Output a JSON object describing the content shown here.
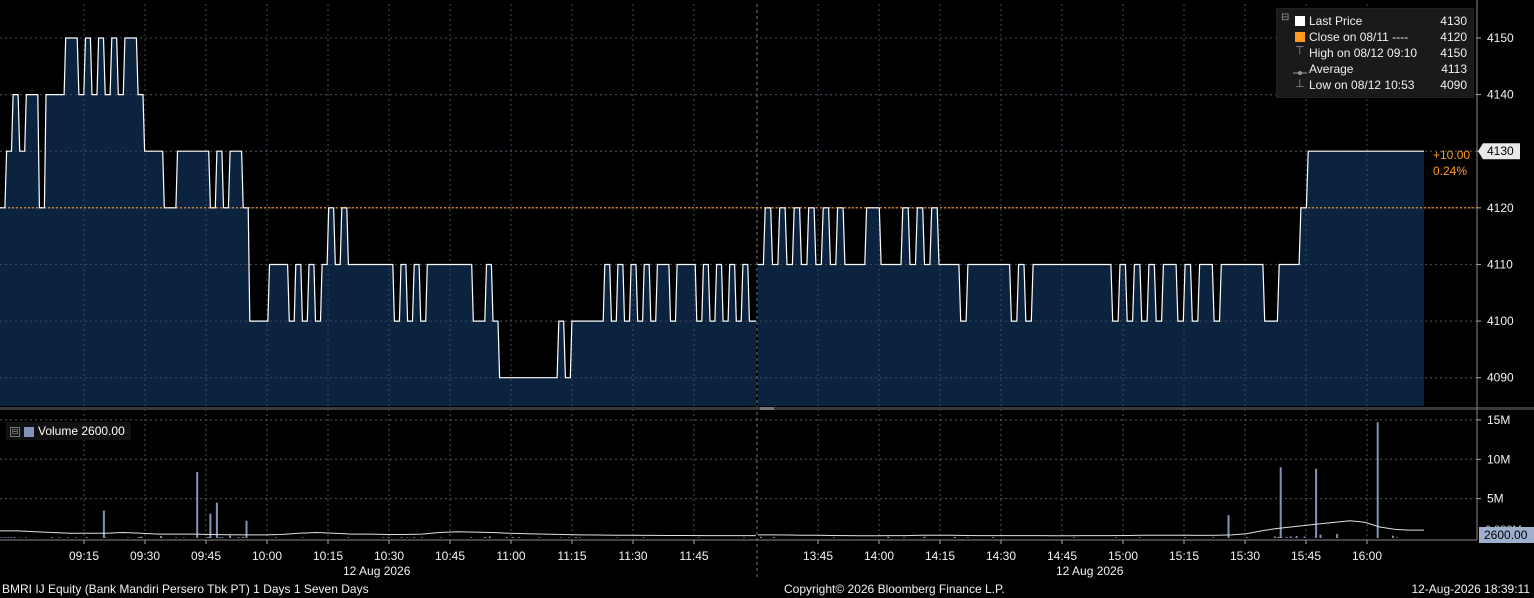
{
  "chart_data": {
    "type": "area",
    "ylim": [
      4085,
      4156
    ],
    "price_ticks": [
      4090,
      4100,
      4110,
      4120,
      4130,
      4140,
      4150
    ],
    "volume_ticks": [
      {
        "v": 15,
        "label": "15M"
      },
      {
        "v": 10,
        "label": "10M"
      },
      {
        "v": 5,
        "label": "5M"
      }
    ],
    "volume_ylim": [
      0,
      15.5
    ],
    "volume_unit": "M",
    "session1_time_labels": [
      "09:15",
      "09:30",
      "09:45",
      "10:00",
      "10:15",
      "10:30",
      "10:45",
      "11:00",
      "11:15",
      "11:30",
      "11:45"
    ],
    "session2_time_labels": [
      "13:45",
      "14:00",
      "14:15",
      "14:30",
      "14:45",
      "15:00",
      "15:15",
      "15:30",
      "15:45",
      "16:00"
    ],
    "date_label": "12 Aug 2026",
    "previous_close": 4120,
    "last_price": 4130,
    "last_price_tag": "4130",
    "change_abs": "+10.00",
    "change_pct": "0.24%",
    "session1": [
      4120,
      4130,
      4140,
      4130,
      4140,
      4140,
      4120,
      4140,
      4140,
      4140,
      4150,
      4150,
      4140,
      4150,
      4140,
      4150,
      4140,
      4150,
      4140,
      4150,
      4150,
      4140,
      4130,
      4130,
      4130,
      4120,
      4120,
      4130,
      4130,
      4130,
      4130,
      4130,
      4120,
      4130,
      4120,
      4130,
      4130,
      4120,
      4100,
      4100,
      4100,
      4110,
      4110,
      4110,
      4100,
      4110,
      4100,
      4110,
      4100,
      4110,
      4120,
      4110,
      4120,
      4110,
      4110,
      4110,
      4110,
      4110,
      4110,
      4110,
      4100,
      4110,
      4100,
      4110,
      4100,
      4110,
      4110,
      4110,
      4110,
      4110,
      4110,
      4110,
      4100,
      4100,
      4110,
      4100,
      4090,
      4090,
      4090,
      4090,
      4090,
      4090,
      4090,
      4090,
      4090,
      4100,
      4090,
      4100,
      4100,
      4100,
      4100,
      4100,
      4110,
      4100,
      4110,
      4100,
      4110,
      4100,
      4110,
      4100,
      4110,
      4110,
      4100,
      4110,
      4110,
      4110,
      4100,
      4110,
      4100,
      4110,
      4100,
      4110,
      4100,
      4110,
      4100
    ],
    "session2": [
      4110,
      4120,
      4110,
      4120,
      4110,
      4120,
      4110,
      4120,
      4110,
      4120,
      4110,
      4120,
      4110,
      4110,
      4110,
      4120,
      4120,
      4110,
      4110,
      4110,
      4120,
      4110,
      4120,
      4110,
      4120,
      4110,
      4110,
      4110,
      4100,
      4110,
      4110,
      4110,
      4110,
      4110,
      4110,
      4100,
      4110,
      4100,
      4110,
      4110,
      4110,
      4110,
      4110,
      4110,
      4110,
      4110,
      4110,
      4110,
      4110,
      4100,
      4110,
      4100,
      4110,
      4100,
      4110,
      4100,
      4110,
      4110,
      4100,
      4110,
      4100,
      4110,
      4110,
      4100,
      4110,
      4110,
      4110,
      4110,
      4110,
      4110,
      4100,
      4100,
      4110,
      4110,
      4110,
      4120,
      4130,
      4130,
      4130,
      4130,
      4130,
      4130,
      4130,
      4130,
      4130,
      4130,
      4130,
      4130,
      4130,
      4130,
      4130,
      4130
    ],
    "volume_spikes_s1": [
      [
        0.1,
        0.07
      ],
      [
        0.5,
        0.06
      ],
      [
        0.9,
        0.09
      ],
      [
        1.3,
        0.08
      ],
      [
        1.7,
        0.07
      ],
      [
        2.2,
        0.1
      ],
      [
        3.0,
        0.05
      ],
      [
        4.0,
        0.06
      ],
      [
        5.5,
        0.04
      ],
      [
        7.9,
        0.1
      ],
      [
        9.0,
        0.08
      ],
      [
        10.3,
        0.07
      ],
      [
        11.6,
        0.08
      ],
      [
        13.2,
        0.1
      ],
      [
        16.0,
        0.07
      ],
      [
        19.5,
        0.06
      ],
      [
        21.1,
        0.13
      ],
      [
        21.5,
        0.16
      ],
      [
        24.5,
        0.25
      ],
      [
        26.8,
        0.06
      ],
      [
        28.0,
        0.05
      ],
      [
        31.4,
        0.07
      ],
      [
        31.7,
        0.12
      ],
      [
        33.4,
        0.1
      ],
      [
        33.8,
        0.09
      ],
      [
        35.0,
        0.3
      ],
      [
        36.3,
        0.12
      ],
      [
        37.0,
        0.14
      ],
      [
        42.0,
        0.07
      ],
      [
        46.0,
        0.06
      ],
      [
        53.0,
        0.08
      ],
      [
        58.3,
        0.08
      ],
      [
        59.1,
        0.11
      ],
      [
        61.1,
        0.1
      ],
      [
        62.0,
        0.08
      ],
      [
        63.0,
        0.09
      ],
      [
        64.2,
        0.07
      ],
      [
        67.0,
        0.06
      ],
      [
        71.7,
        0.09
      ],
      [
        73.8,
        0.14
      ],
      [
        74.5,
        0.19
      ],
      [
        77.1,
        0.12
      ],
      [
        78.0,
        0.11
      ],
      [
        79.0,
        0.1
      ],
      [
        82.0,
        0.08
      ],
      [
        85.3,
        0.06
      ],
      [
        86.6,
        0.07
      ],
      [
        87.6,
        0.1
      ],
      [
        88.2,
        0.09
      ],
      [
        93.9,
        0.05
      ],
      [
        97.9,
        0.08
      ],
      [
        106.3,
        0.07
      ],
      [
        113.2,
        0.06
      ]
    ],
    "volume_spikes_s2": [
      [
        0.4,
        0.15
      ],
      [
        2.2,
        0.11
      ],
      [
        10.5,
        0.08
      ],
      [
        18.0,
        0.15
      ],
      [
        20.2,
        0.07
      ],
      [
        23.0,
        0.16
      ],
      [
        27.2,
        0.14
      ],
      [
        29.0,
        0.08
      ],
      [
        32.5,
        0.12
      ],
      [
        43.7,
        0.07
      ],
      [
        49.5,
        0.08
      ],
      [
        52.7,
        0.09
      ],
      [
        59.0,
        0.09
      ],
      [
        62.9,
        0.09
      ],
      [
        67.6,
        0.1
      ],
      [
        71.4,
        0.19
      ],
      [
        71.9,
        0.14
      ],
      [
        72.3,
        0.11
      ],
      [
        73.6,
        0.19
      ],
      [
        73.0,
        0.14
      ],
      [
        74.4,
        0.26
      ],
      [
        75.5,
        0.18
      ],
      [
        77.7,
        0.42
      ],
      [
        87.7,
        0.29
      ],
      [
        88.3,
        0.08
      ]
    ],
    "volume_spikes_s2_big": [
      [
        77.1,
        8.8
      ],
      [
        85.6,
        14.7
      ],
      [
        65.0,
        2.9
      ],
      [
        72.2,
        9.0
      ],
      [
        80.0,
        0.5
      ]
    ],
    "volume_spikes_s1_big": [
      [
        30.0,
        8.4
      ],
      [
        32.0,
        3.1
      ],
      [
        33.0,
        4.5
      ],
      [
        15.8,
        3.5
      ],
      [
        37.5,
        2.2
      ]
    ],
    "volume_avg_s1": [
      0.9,
      0.9,
      0.8,
      0.7,
      0.6,
      0.6,
      0.6,
      0.7,
      0.6,
      0.5,
      0.5,
      0.5,
      0.45,
      0.42,
      0.4,
      0.4,
      0.45,
      0.6,
      0.7,
      0.6,
      0.5,
      0.5,
      0.45,
      0.45,
      0.5,
      0.7,
      0.8,
      0.75,
      0.7,
      0.6,
      0.55,
      0.5,
      0.45,
      0.4,
      0.38,
      0.36,
      0.34,
      0.33,
      0.32,
      0.32,
      0.3,
      0.3,
      0.3,
      0.3
    ],
    "volume_avg_s2": [
      0.4,
      0.4,
      0.38,
      0.36,
      0.34,
      0.32,
      0.3,
      0.28,
      0.28,
      0.3,
      0.3,
      0.35,
      0.35,
      0.36,
      0.32,
      0.3,
      0.3,
      0.3,
      0.3,
      0.3,
      0.28,
      0.28,
      0.3,
      0.3,
      0.3,
      0.32,
      0.34,
      0.35,
      0.35,
      0.34,
      0.33,
      0.35,
      0.4,
      0.55,
      0.9,
      1.2,
      1.4,
      1.6,
      1.8,
      2.0,
      2.2,
      2.0,
      1.4,
      1.1,
      1.0,
      1.0
    ],
    "volume_last": "2600.00",
    "volume_tag_back": "0.883M"
  },
  "legend": {
    "last_price": {
      "name": "Last Price",
      "value": "4130",
      "color": "#ffffff"
    },
    "close": {
      "name": "Close on 08/11 ---- ",
      "value": "4120",
      "color": "#ff9a1f"
    },
    "high": {
      "name": "High on 08/12 09:10",
      "value": "4150",
      "color": "#9a9a9a"
    },
    "average": {
      "name": "Average",
      "value": "4113",
      "color": "#9a9a9a"
    },
    "low": {
      "name": "Low on 08/12 10:53",
      "value": "4090",
      "color": "#9a9a9a"
    }
  },
  "volume_legend": {
    "name": "Volume",
    "value": "2600.00",
    "swatch_color": "#8393b8",
    "collapse_symbol": "⊟"
  },
  "legend_collapse_symbol": "⊟",
  "footer": {
    "left": "BMRI IJ Equity (Bank Mandiri Persero Tbk PT) 1 Days 1 Seven Days",
    "center": "Copyright© 2026 Bloomberg Finance L.P.",
    "right": "12-Aug-2026 18:39:11"
  },
  "colors": {
    "area_fill": "#0c2340",
    "price_line": "#ffffff",
    "close_line": "#ff9a1f",
    "grid": "#555555",
    "volume_bar": "#8393b8",
    "tag_bg": "#e8e8e8"
  }
}
